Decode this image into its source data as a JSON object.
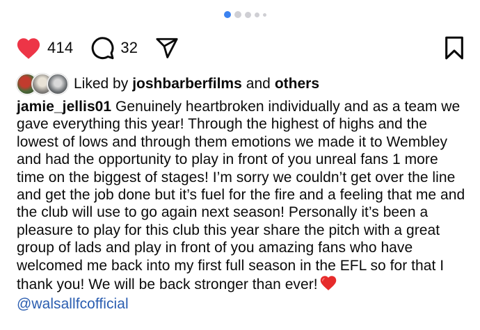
{
  "carousel": {
    "total": 5,
    "active_index": 0
  },
  "actions": {
    "likes_count": "414",
    "comments_count": "32",
    "icons": [
      "heart-icon",
      "comment-icon",
      "share-icon",
      "bookmark-icon"
    ],
    "like_color": "#ed3547"
  },
  "liked_by": {
    "prefix": "Liked by",
    "user": "joshbarberfilms",
    "and": "and",
    "others": "others"
  },
  "caption": {
    "username": "jamie_jellis01",
    "text": "Genuinely heartbroken individually and as a team we gave everything this year! Through the highest of highs and the lowest of lows and through them emotions we made it to Wembley and had the opportunity to play in front of you unreal fans 1 more time on the biggest of stages! I’m sorry we couldn’t get over the line and get the job done but it’s fuel for the fire and a feeling that me and the club will use to go again next season! Personally it’s been a pleasure to play for this club this year share the pitch with a great group of lads and play in front of you amazing fans who have welcomed me back into my first full season in the EFL so for that I thank you! We will be back stronger than ever!",
    "emoji": "red-heart-emoji",
    "mention": "@walsallfcofficial"
  },
  "colors": {
    "link": "#2a5db0",
    "dot_active": "#3b82f0",
    "dot_inactive": "#cfcfd4"
  }
}
